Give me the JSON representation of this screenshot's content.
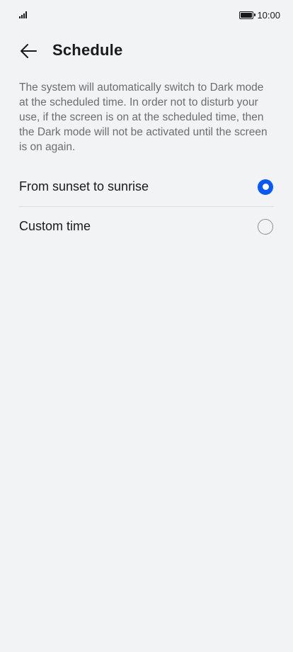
{
  "status_bar": {
    "time": "10:00",
    "signal_icon": "signal-icon",
    "battery_icon": "battery-icon"
  },
  "header": {
    "title": "Schedule",
    "back_icon": "back-arrow-icon"
  },
  "description": "The system will automatically switch to Dark mode at the scheduled time. In order not to disturb your use, if the screen is on at the scheduled time, then the Dark mode will not be activated until the screen is on again.",
  "options": [
    {
      "label": "From sunset to sunrise",
      "selected": true
    },
    {
      "label": "Custom time",
      "selected": false
    }
  ],
  "colors": {
    "accent": "#0a59f7",
    "background": "#f1f3f5",
    "secondary_text": "#6b6d70"
  }
}
